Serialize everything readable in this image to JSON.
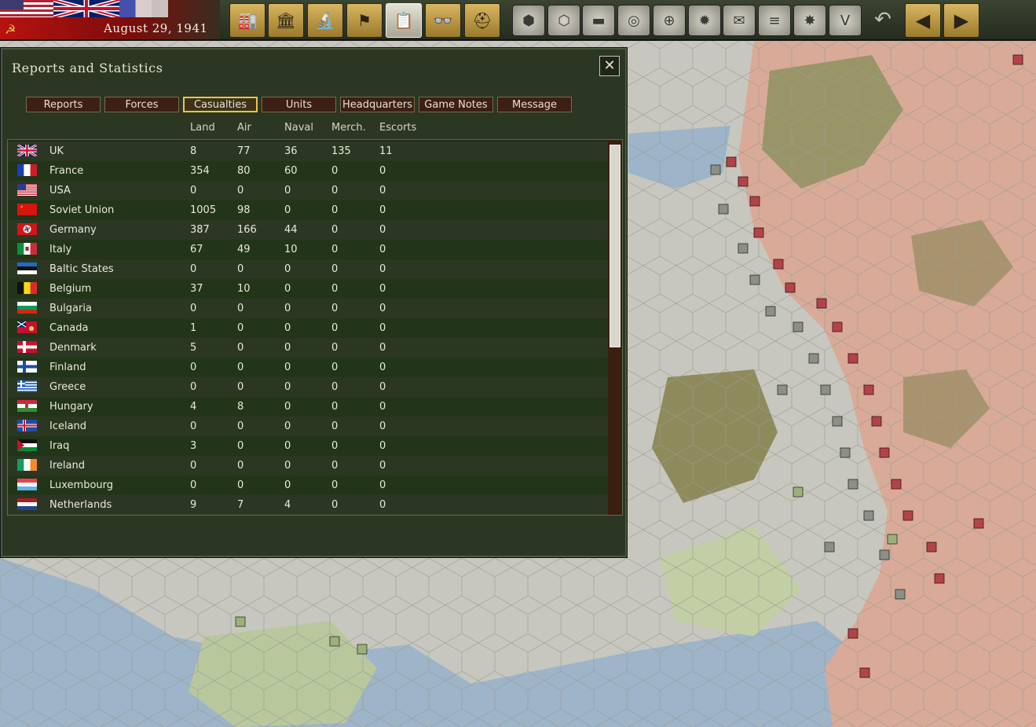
{
  "topbar": {
    "date": "August 29, 1941",
    "toolbar_buttons": [
      {
        "name": "production-button",
        "icon": "factory-icon",
        "glyph": "🏭"
      },
      {
        "name": "diplomacy-button",
        "icon": "capitol-icon",
        "glyph": "🏛"
      },
      {
        "name": "research-button",
        "icon": "microscope-icon",
        "glyph": "🔬"
      },
      {
        "name": "objectives-button",
        "icon": "flag-icon",
        "glyph": "⚑"
      },
      {
        "name": "reports-button",
        "icon": "clipboard-icon",
        "glyph": "📋"
      },
      {
        "name": "intelligence-button",
        "icon": "binoculars-icon",
        "glyph": "👓"
      },
      {
        "name": "units-button",
        "icon": "helmet-icon",
        "glyph": "⛑"
      }
    ],
    "map_buttons": [
      {
        "name": "hex-toggle-button",
        "icon": "hexagon-icon",
        "glyph": "⬢"
      },
      {
        "name": "hex-grid-button",
        "icon": "hex-grid-icon",
        "glyph": "⬡"
      },
      {
        "name": "supply-button",
        "icon": "tank-icon",
        "glyph": "▬"
      },
      {
        "name": "resources-button",
        "icon": "coins-icon",
        "glyph": "◎"
      },
      {
        "name": "target-button",
        "icon": "crosshair-icon",
        "glyph": "⊕"
      },
      {
        "name": "weather-button",
        "icon": "sun-icon",
        "glyph": "✹"
      },
      {
        "name": "mail-button",
        "icon": "envelope-icon",
        "glyph": "✉"
      },
      {
        "name": "railway-button",
        "icon": "railway-icon",
        "glyph": "≡"
      },
      {
        "name": "combat-button",
        "icon": "explosion-icon",
        "glyph": "✸"
      },
      {
        "name": "victory-button",
        "icon": "victory-v-icon",
        "glyph": "V"
      }
    ],
    "undo_glyph": "↶",
    "prev_glyph": "◀",
    "next_glyph": "▶"
  },
  "dialog": {
    "title": "Reports and Statistics",
    "close_glyph": "✕",
    "tabs": [
      {
        "label": "Reports",
        "active": false
      },
      {
        "label": "Forces",
        "active": false
      },
      {
        "label": "Casualties",
        "active": true
      },
      {
        "label": "Units",
        "active": false
      },
      {
        "label": "Headquarters",
        "active": false
      },
      {
        "label": "Game Notes",
        "active": false
      },
      {
        "label": "Message",
        "active": false
      }
    ],
    "columns": [
      "Land",
      "Air",
      "Naval",
      "Merch.",
      "Escorts"
    ],
    "rows": [
      {
        "country": "UK",
        "flag": "uk",
        "land": "8",
        "air": "77",
        "naval": "36",
        "merch": "135",
        "escorts": "11"
      },
      {
        "country": "France",
        "flag": "france",
        "land": "354",
        "air": "80",
        "naval": "60",
        "merch": "0",
        "escorts": "0"
      },
      {
        "country": "USA",
        "flag": "usa",
        "land": "0",
        "air": "0",
        "naval": "0",
        "merch": "0",
        "escorts": "0"
      },
      {
        "country": "Soviet Union",
        "flag": "soviet",
        "land": "1005",
        "air": "98",
        "naval": "0",
        "merch": "0",
        "escorts": "0"
      },
      {
        "country": "Germany",
        "flag": "germany",
        "land": "387",
        "air": "166",
        "naval": "44",
        "merch": "0",
        "escorts": "0"
      },
      {
        "country": "Italy",
        "flag": "italy",
        "land": "67",
        "air": "49",
        "naval": "10",
        "merch": "0",
        "escorts": "0"
      },
      {
        "country": "Baltic States",
        "flag": "baltic",
        "land": "0",
        "air": "0",
        "naval": "0",
        "merch": "0",
        "escorts": "0"
      },
      {
        "country": "Belgium",
        "flag": "belgium",
        "land": "37",
        "air": "10",
        "naval": "0",
        "merch": "0",
        "escorts": "0"
      },
      {
        "country": "Bulgaria",
        "flag": "bulgaria",
        "land": "0",
        "air": "0",
        "naval": "0",
        "merch": "0",
        "escorts": "0"
      },
      {
        "country": "Canada",
        "flag": "canada",
        "land": "1",
        "air": "0",
        "naval": "0",
        "merch": "0",
        "escorts": "0"
      },
      {
        "country": "Denmark",
        "flag": "denmark",
        "land": "5",
        "air": "0",
        "naval": "0",
        "merch": "0",
        "escorts": "0"
      },
      {
        "country": "Finland",
        "flag": "finland",
        "land": "0",
        "air": "0",
        "naval": "0",
        "merch": "0",
        "escorts": "0"
      },
      {
        "country": "Greece",
        "flag": "greece",
        "land": "0",
        "air": "0",
        "naval": "0",
        "merch": "0",
        "escorts": "0"
      },
      {
        "country": "Hungary",
        "flag": "hungary",
        "land": "4",
        "air": "8",
        "naval": "0",
        "merch": "0",
        "escorts": "0"
      },
      {
        "country": "Iceland",
        "flag": "iceland",
        "land": "0",
        "air": "0",
        "naval": "0",
        "merch": "0",
        "escorts": "0"
      },
      {
        "country": "Iraq",
        "flag": "iraq",
        "land": "3",
        "air": "0",
        "naval": "0",
        "merch": "0",
        "escorts": "0"
      },
      {
        "country": "Ireland",
        "flag": "ireland",
        "land": "0",
        "air": "0",
        "naval": "0",
        "merch": "0",
        "escorts": "0"
      },
      {
        "country": "Luxembourg",
        "flag": "luxembourg",
        "land": "0",
        "air": "0",
        "naval": "0",
        "merch": "0",
        "escorts": "0"
      },
      {
        "country": "Netherlands",
        "flag": "netherlands",
        "land": "9",
        "air": "7",
        "naval": "4",
        "merch": "0",
        "escorts": "0"
      }
    ]
  },
  "colors": {
    "dialog_bg": "#2b3722",
    "row_alt": "#223518",
    "tab_active_border": "#e8c54a",
    "axis_territory": "#c9c9c1",
    "soviet_territory": "#d9aa98",
    "forest": "#8f8a5c",
    "sea": "#9bb3c9"
  }
}
